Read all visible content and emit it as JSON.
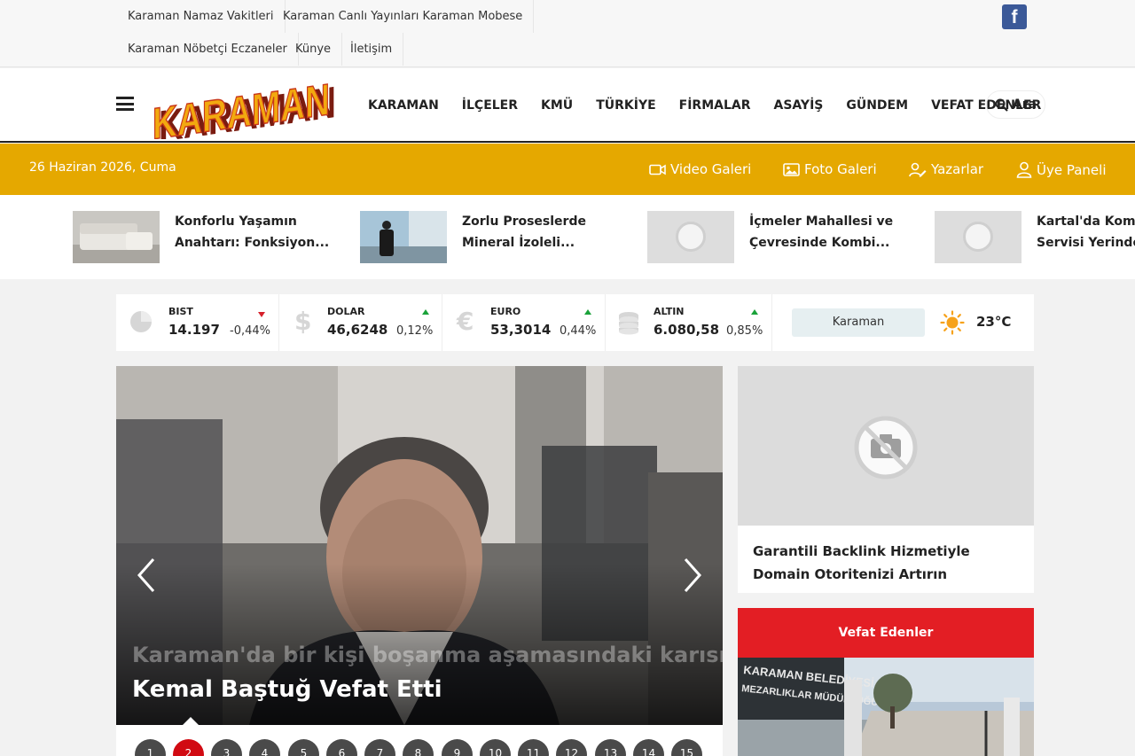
{
  "topbar": {
    "links": [
      "Karaman Namaz Vakitleri",
      "Karaman Canlı Yayınları Karaman Mobese",
      "Karaman Nöbetçi Eczaneler",
      "Künye",
      "İletişim"
    ],
    "facebook_glyph": "f"
  },
  "header": {
    "logo_text": "KARAMAN",
    "nav": [
      "KARAMAN",
      "İLÇELER",
      "KMÜ",
      "TÜRKİYE",
      "FİRMALAR",
      "ASAYİŞ",
      "GÜNDEM",
      "VEFAT EDENLER"
    ],
    "search_label": "Ara"
  },
  "subbar": {
    "date": "26 Haziran 2026, Cuma",
    "links": [
      "Video Galeri",
      "Foto Galeri",
      "Yazarlar",
      "Üye Paneli"
    ]
  },
  "ticker": [
    {
      "line1": "Konforlu Yaşamın",
      "line2": "Anahtarı: Fonksiyon..."
    },
    {
      "line1": "Zorlu Proseslerde",
      "line2": "Mineral İzoleli..."
    },
    {
      "line1": "İçmeler Mahallesi ve",
      "line2": "Çevresinde Kombi..."
    },
    {
      "line1": "Kartal'da Kombi",
      "line2": "Servisi Yerinde T"
    }
  ],
  "market": [
    {
      "name": "BIST",
      "value": "14.197",
      "change": "-0,44%",
      "direction": "down",
      "icon": "pie-chart-icon"
    },
    {
      "name": "DOLAR",
      "value": "46,6248",
      "change": "0,12%",
      "direction": "up",
      "icon": "dollar-icon"
    },
    {
      "name": "EURO",
      "value": "53,3014",
      "change": "0,44%",
      "direction": "up",
      "icon": "euro-icon"
    },
    {
      "name": "ALTIN",
      "value": "6.080,58",
      "change": "0,85%",
      "direction": "up",
      "icon": "coins-icon"
    }
  ],
  "weather": {
    "city": "Karaman",
    "temperature": "23°C"
  },
  "slider": {
    "ghost_title": "Karaman'da bir kişi boşanma aşamasındaki karısını",
    "title": "Kemal Baştuğ Vefat Etti",
    "pages": [
      "1",
      "2",
      "3",
      "4",
      "5",
      "6",
      "7",
      "8",
      "9",
      "10",
      "11",
      "12",
      "13",
      "14",
      "15"
    ],
    "active_page": "2"
  },
  "promo": {
    "title": "Garantili Backlink Hizmetiyle Domain Otoritenizi Artırın"
  },
  "vefat": {
    "heading": "Vefat Edenler",
    "sign_text_1": "KARAMAN BELEDİYESİ",
    "sign_text_2": "MEZARLIKLAR MÜDÜRLÜĞÜ"
  },
  "colors": {
    "accent_yellow": "#e5a800",
    "red": "#e31e24",
    "pager_active": "#d10a12",
    "up": "#1aa23a",
    "down": "#d6202b",
    "facebook": "#3b5998"
  }
}
